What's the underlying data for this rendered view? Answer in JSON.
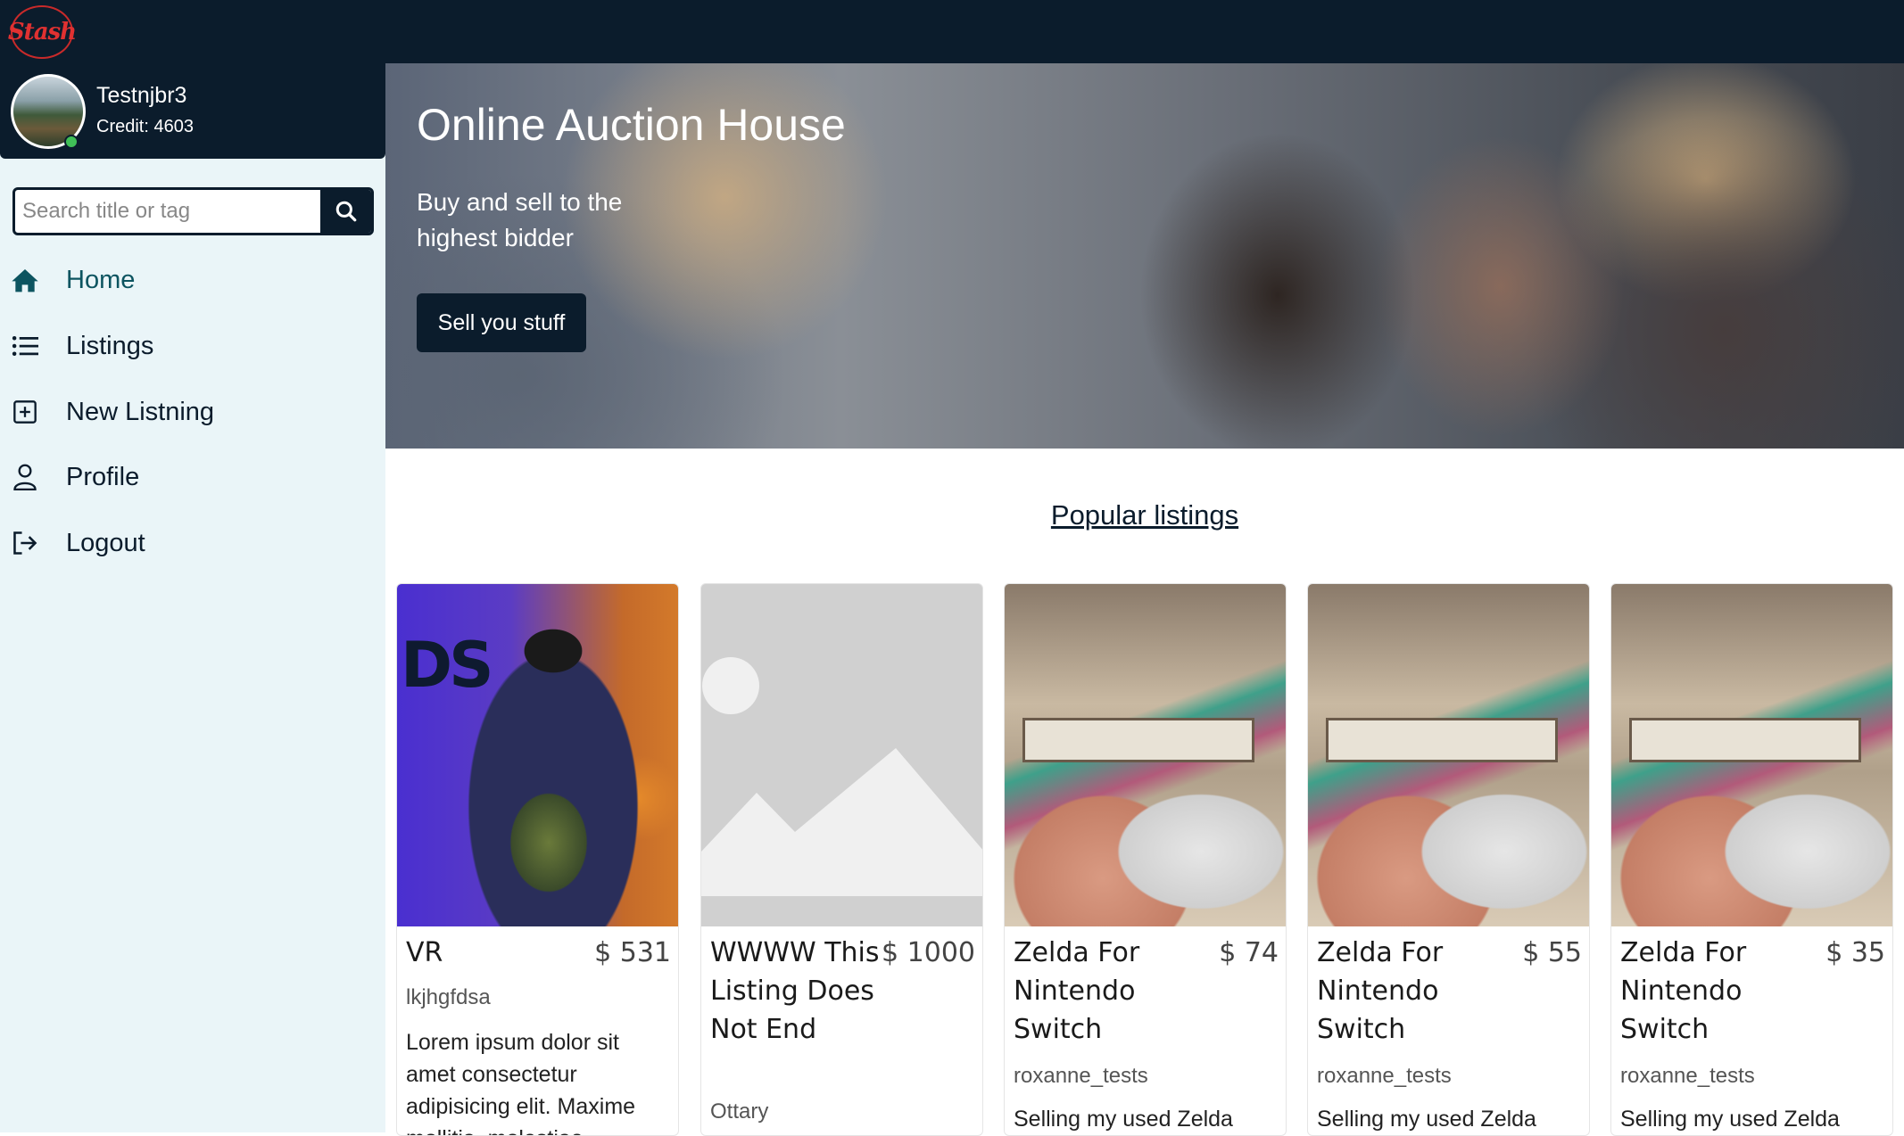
{
  "app": {
    "logo_text": "Stash"
  },
  "user": {
    "name": "Testnjbr3",
    "credit": "Credit: 4603"
  },
  "search": {
    "placeholder": "Search title or tag",
    "value": ""
  },
  "nav": [
    {
      "label": "Home",
      "icon": "home-icon",
      "active": true
    },
    {
      "label": "Listings",
      "icon": "list-icon"
    },
    {
      "label": "New Listning",
      "icon": "plus-square-icon"
    },
    {
      "label": "Profile",
      "icon": "user-icon"
    },
    {
      "label": "Logout",
      "icon": "logout-icon"
    }
  ],
  "hero": {
    "title": "Online Auction House",
    "subtitle": "Buy and sell to the highest bidder",
    "button": "Sell you stuff"
  },
  "section": {
    "title": "Popular listings"
  },
  "listings": [
    {
      "title": "VR",
      "price": "$ 531",
      "seller": "lkjhgfdsa",
      "description": "Lorem ipsum dolor sit amet consectetur adipisicing elit. Maxime mollitia, molestiae",
      "image": "vr-headset-photo"
    },
    {
      "title": "WWWW This Listing Does Not End",
      "price": "$ 1000",
      "seller": "Ottary",
      "description": "",
      "image": "placeholder-image"
    },
    {
      "title": "Zelda For Nintendo Switch",
      "price": "$ 74",
      "seller": "roxanne_tests",
      "description": "Selling my used Zelda",
      "image": "controller-photo"
    },
    {
      "title": "Zelda For Nintendo Switch",
      "price": "$ 55",
      "seller": "roxanne_tests",
      "description": "Selling my used Zelda",
      "image": "controller-photo"
    },
    {
      "title": "Zelda For Nintendo Switch",
      "price": "$ 35",
      "seller": "roxanne_tests",
      "description": "Selling my used Zelda",
      "image": "controller-photo"
    }
  ],
  "colors": {
    "navy": "#0b1c2c",
    "sidebar_bg": "#eaf5f8",
    "active_teal": "#0c5460",
    "online": "#40c057",
    "logo_red": "#e03131"
  }
}
